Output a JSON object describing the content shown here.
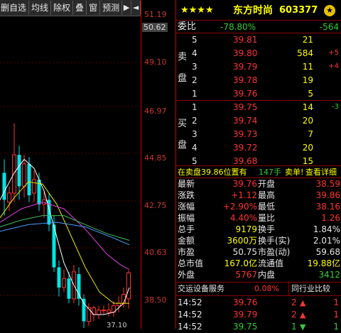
{
  "toolbar": {
    "items": [
      "删自选",
      "均线",
      "除权",
      "叠",
      "窗",
      "预测",
      "▶",
      "◄"
    ]
  },
  "price_axis": {
    "labels": [
      "51.19",
      "50.62",
      "49.10",
      "46.97",
      "44.85",
      "42.75",
      "40.63",
      "38.50"
    ],
    "highlight": "50.62"
  },
  "chart_bottom_label": "37.10",
  "header": {
    "stars": "★★★★",
    "name": "东方时尚",
    "code": "603377"
  },
  "weibi": {
    "label": "委比",
    "ratio": "-78.80%",
    "diff": "-564"
  },
  "sell_label": "卖盘",
  "buy_label": "买盘",
  "sells": [
    {
      "level": "5",
      "price": "39.81",
      "vol": "21",
      "chg": ""
    },
    {
      "level": "4",
      "price": "39.80",
      "vol": "584",
      "chg": "+5"
    },
    {
      "level": "3",
      "price": "39.79",
      "vol": "11",
      "chg": "+4"
    },
    {
      "level": "2",
      "price": "39.78",
      "vol": "19",
      "chg": ""
    },
    {
      "level": "1",
      "price": "39.76",
      "vol": "5",
      "chg": ""
    }
  ],
  "buys": [
    {
      "level": "1",
      "price": "39.75",
      "vol": "14",
      "chg": "-3"
    },
    {
      "level": "2",
      "price": "39.74",
      "vol": "20",
      "chg": ""
    },
    {
      "level": "3",
      "price": "39.73",
      "vol": "7",
      "chg": ""
    },
    {
      "level": "4",
      "price": "39.72",
      "vol": "20",
      "chg": ""
    },
    {
      "level": "5",
      "price": "39.68",
      "vol": "15",
      "chg": ""
    }
  ],
  "notice": {
    "text": "在卖盘39.86位置有",
    "qty": "147手",
    "action": "卖单!",
    "link": "查看详细"
  },
  "stats": [
    {
      "l1": "最新",
      "v1": "39.76",
      "l2": "开盘",
      "v2": "38.59"
    },
    {
      "l1": "涨跌",
      "v1": "+1.12",
      "l2": "最高",
      "v2": "39.86"
    },
    {
      "l1": "涨幅",
      "v1": "+2.90%",
      "l2": "最低",
      "v2": "38.16"
    },
    {
      "l1": "振幅",
      "v1": "4.40%",
      "l2": "量比",
      "v2": "1.26"
    },
    {
      "l1": "总手",
      "v1": "9179",
      "l2": "换手",
      "v2": "1.84%"
    },
    {
      "l1": "金额",
      "v1": "3600万",
      "l2": "换手(实)",
      "v2": "2.01%"
    },
    {
      "l1": "市盈",
      "v1": "50.75",
      "l2": "市盈(动)",
      "v2": "59.68"
    },
    {
      "l1": "总市值",
      "v1": "167.0亿",
      "l2": "流通值",
      "v2": "19.88亿"
    },
    {
      "l1": "外盘",
      "v1": "5767",
      "l2": "内盘",
      "v2": "3412"
    }
  ],
  "industry": {
    "name": "交运设备服务",
    "pct": "0.08%",
    "compare": "同行业比较"
  },
  "ticks": [
    {
      "time": "14:52",
      "price": "39.76",
      "vol": "2",
      "dir": "up",
      "num": "1"
    },
    {
      "time": "14:52",
      "price": "39.79",
      "vol": "2",
      "dir": "up",
      "num": "1"
    },
    {
      "time": "14:52",
      "price": "39.75",
      "vol": "1",
      "dir": "down",
      "num": "1"
    }
  ],
  "colors": {
    "up": "#ff3333",
    "down": "#33cc33",
    "yellow": "#ffff00",
    "cyan": "#00e5e5",
    "border": "#8b0000"
  }
}
